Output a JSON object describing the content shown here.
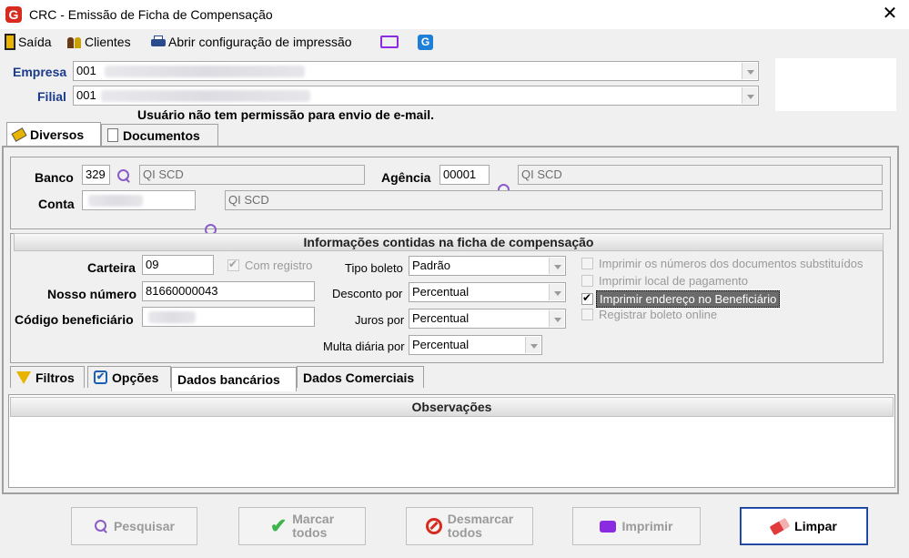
{
  "window": {
    "title": "CRC - Emissão de Ficha de Compensação",
    "logo": "G"
  },
  "toolbar": {
    "exit_label": "Saída",
    "clients_label": "Clientes",
    "print_config_label": "Abrir configuração de impressão"
  },
  "header": {
    "empresa_label": "Empresa",
    "empresa_value": "001",
    "filial_label": "Filial",
    "filial_value": "001",
    "warning": "Usuário não tem permissão para envio de e-mail."
  },
  "top_tabs": [
    "Diversos",
    "Documentos"
  ],
  "bank": {
    "banco_label": "Banco",
    "banco_code": "329",
    "banco_name": "QI SCD",
    "agencia_label": "Agência",
    "agencia_code": "00001",
    "agencia_name": "QI SCD",
    "conta_label": "Conta",
    "conta_name": "QI SCD"
  },
  "ficha": {
    "header": "Informações contidas na ficha de compensação",
    "carteira_label": "Carteira",
    "carteira_value": "09",
    "com_registro_label": "Com registro",
    "nosso_numero_label": "Nosso número",
    "nosso_numero_value": "81660000043",
    "codigo_beneficiario_label": "Código beneficiário",
    "tipo_boleto_label": "Tipo boleto",
    "tipo_boleto_value": "Padrão",
    "desconto_label": "Desconto por",
    "desconto_value": "Percentual",
    "juros_label": "Juros por",
    "juros_value": "Percentual",
    "multa_label": "Multa diária por",
    "multa_value": "Percentual",
    "opt1": "Imprimir os números dos documentos substituídos",
    "opt2": "Imprimir local de pagamento",
    "opt3": "Imprimir endereço no Beneficiário",
    "opt4": "Registrar boleto online"
  },
  "bottom_tabs": [
    "Filtros",
    "Opções",
    "Dados bancários",
    "Dados Comerciais"
  ],
  "observacoes_header": "Observações",
  "buttons": {
    "pesquisar": "Pesquisar",
    "marcar_1": "Marcar",
    "marcar_2": "todos",
    "desmarcar_1": "Desmarcar",
    "desmarcar_2": "todos",
    "imprimir": "Imprimir",
    "limpar": "Limpar"
  },
  "colors": {
    "label_blue": "#1a3a8c",
    "warning_red": "#8b0000",
    "accent_purple": "#8a5cc8"
  }
}
